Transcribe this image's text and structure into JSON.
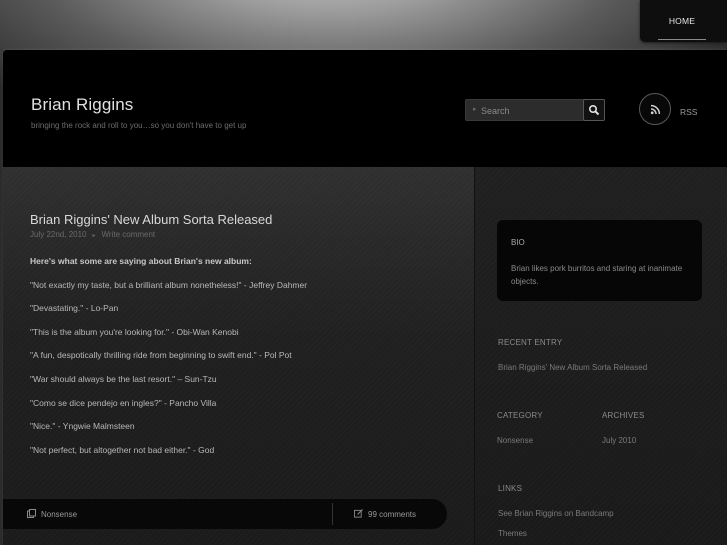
{
  "nav": {
    "home_label": "HOME"
  },
  "header": {
    "title": "Brian Riggins",
    "tagline": "bringing the rock and roll to you…so you don't have to get up",
    "search_placeholder": "Search",
    "rss_label": "RSS"
  },
  "post": {
    "title": "Brian Riggins' New Album Sorta Released",
    "date": "July 22nd, 2010",
    "write_comment": "Write comment",
    "paragraphs": [
      "Here's what some are saying about Brian's new album:",
      "\"Not exactly my taste, but a brilliant album nonetheless!\"    - Jeffrey Dahmer",
      "\"Devastating.\"  - Lo-Pan",
      "\"This is the album you're looking for.\"  - Obi-Wan Kenobi",
      "\"A fun, despotically thrilling ride from beginning to swift end.\"  - Pol Pot",
      "\"War should always be the last resort.\"   – Sun-Tzu",
      "\"Como se dice pendejo en ingles?\"  - Pancho Villa",
      "\"Nice.\"  - Yngwie Malmsteen",
      "\"Not perfect, but altogether not bad either.\"  - God"
    ],
    "category": "Nonsense",
    "comments": "99 comments"
  },
  "sidebar": {
    "bio": {
      "heading": "BIO",
      "text": "Brian likes pork burritos and staring at inanimate objects."
    },
    "recent": {
      "heading": "RECENT ENTRY",
      "item": "Brian Riggins' New Album Sorta Released"
    },
    "category": {
      "heading": "CATEGORY",
      "item": "Nonsense"
    },
    "archives": {
      "heading": "ARCHIVES",
      "item": "July 2010"
    },
    "links": {
      "heading": "LINKS",
      "items": [
        "See Brian Riggins on Bandcamp",
        "Themes"
      ]
    }
  }
}
